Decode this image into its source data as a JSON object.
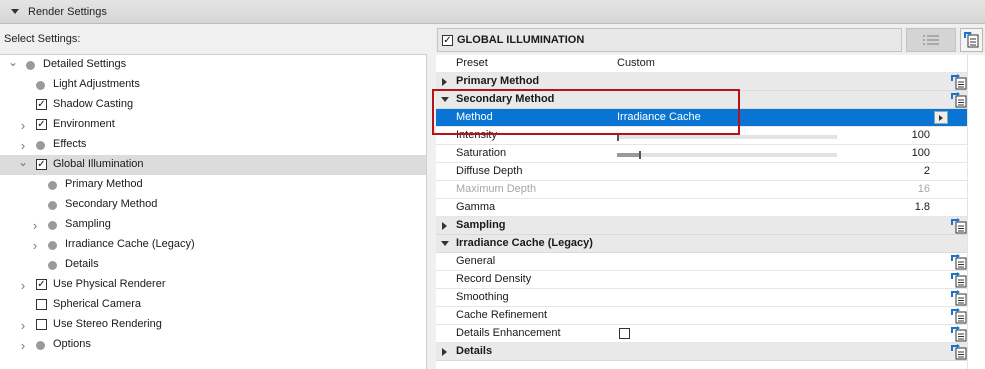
{
  "header": {
    "title": "Render Settings"
  },
  "left": {
    "select_label": "Select Settings:",
    "tree": [
      {
        "label": "Detailed Settings",
        "expander": "down",
        "marker": "bullet",
        "level": 0
      },
      {
        "label": "Light Adjustments",
        "expander": "",
        "marker": "bullet",
        "level": 1
      },
      {
        "label": "Shadow Casting",
        "expander": "",
        "marker": "checkbox",
        "checked": true,
        "level": 1
      },
      {
        "label": "Environment",
        "expander": "right",
        "marker": "checkbox",
        "checked": true,
        "level": 1
      },
      {
        "label": "Effects",
        "expander": "right",
        "marker": "bullet",
        "level": 1
      },
      {
        "label": "Global Illumination",
        "expander": "down",
        "marker": "checkbox",
        "checked": true,
        "level": 1,
        "selected": true
      },
      {
        "label": "Primary Method",
        "expander": "",
        "marker": "bullet",
        "level": 2
      },
      {
        "label": "Secondary Method",
        "expander": "",
        "marker": "bullet",
        "level": 2
      },
      {
        "label": "Sampling",
        "expander": "right",
        "marker": "bullet",
        "level": 2
      },
      {
        "label": "Irradiance Cache (Legacy)",
        "expander": "right",
        "marker": "bullet",
        "level": 2
      },
      {
        "label": "Details",
        "expander": "",
        "marker": "bullet",
        "level": 2
      },
      {
        "label": "Use Physical Renderer",
        "expander": "right",
        "marker": "checkbox",
        "checked": true,
        "level": 1
      },
      {
        "label": "Spherical Camera",
        "expander": "",
        "marker": "checkbox",
        "checked": false,
        "level": 1
      },
      {
        "label": "Use Stereo Rendering",
        "expander": "right",
        "marker": "checkbox",
        "checked": false,
        "level": 1
      },
      {
        "label": "Options",
        "expander": "right",
        "marker": "bullet",
        "level": 1
      }
    ]
  },
  "right": {
    "title": "GLOBAL ILLUMINATION",
    "title_checked": true,
    "rows": [
      {
        "type": "prop",
        "name": "Preset",
        "value": "Custom"
      },
      {
        "type": "group",
        "name": "Primary Method",
        "open": false,
        "icon": true
      },
      {
        "type": "group",
        "name": "Secondary Method",
        "open": true,
        "icon": true
      },
      {
        "type": "selected",
        "name": "Method",
        "value": "Irradiance Cache"
      },
      {
        "type": "slider",
        "name": "Intensity",
        "level": 0.0,
        "num": "100"
      },
      {
        "type": "slider",
        "name": "Saturation",
        "level": 0.1,
        "num": "100"
      },
      {
        "type": "num",
        "name": "Diffuse Depth",
        "num": "2"
      },
      {
        "type": "num",
        "name": "Maximum Depth",
        "num": "16",
        "dim": true
      },
      {
        "type": "num",
        "name": "Gamma",
        "num": "1.8"
      },
      {
        "type": "group",
        "name": "Sampling",
        "open": false,
        "icon": true
      },
      {
        "type": "group",
        "name": "Irradiance Cache (Legacy)",
        "open": true,
        "icon": false
      },
      {
        "type": "prop",
        "name": "General",
        "icon": true
      },
      {
        "type": "prop",
        "name": "Record Density",
        "icon": true
      },
      {
        "type": "prop",
        "name": "Smoothing",
        "icon": true
      },
      {
        "type": "prop",
        "name": "Cache Refinement",
        "icon": true
      },
      {
        "type": "check",
        "name": "Details Enhancement",
        "checked": false,
        "icon": true
      },
      {
        "type": "group",
        "name": "Details",
        "open": false,
        "icon": true
      }
    ]
  }
}
